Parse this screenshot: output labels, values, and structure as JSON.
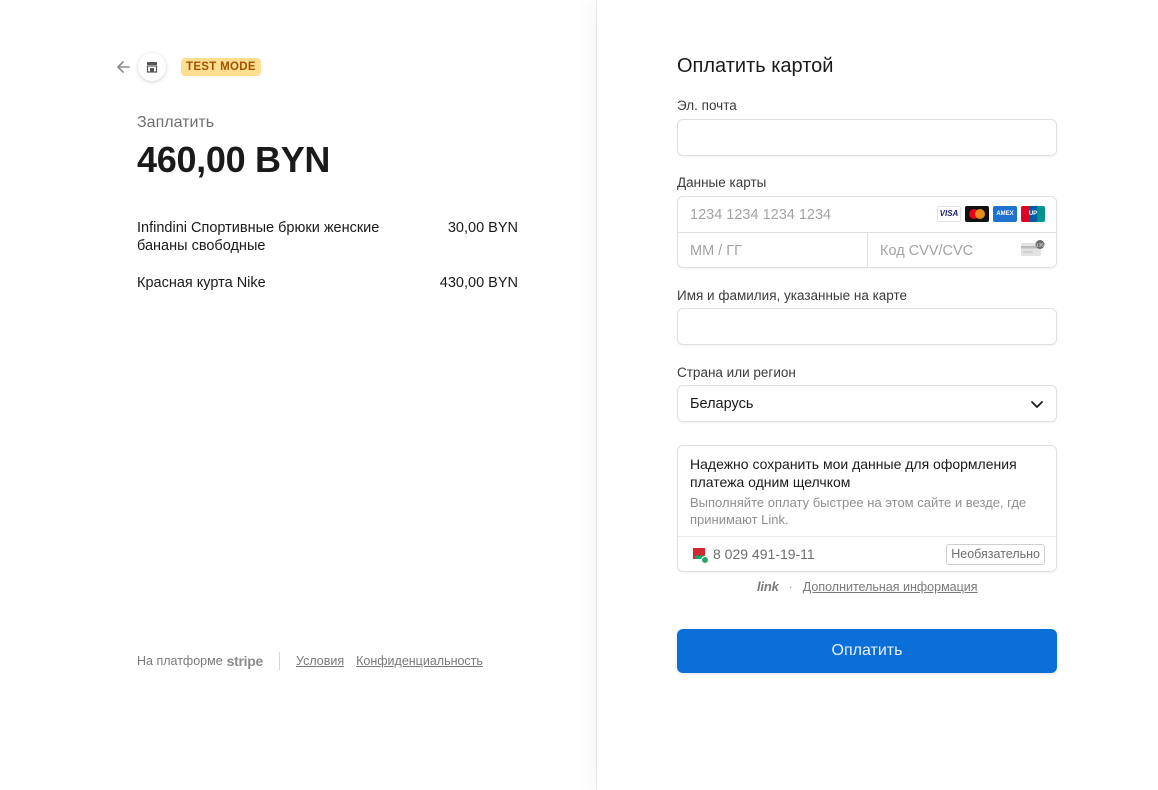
{
  "header": {
    "test_mode_label": "TEST MODE",
    "back_icon": "arrow-left-icon",
    "store_icon": "store-icon"
  },
  "summary": {
    "pay_label": "Заплатить",
    "amount": "460,00 BYN",
    "items": [
      {
        "name": "Infindini Спортивные брюки женские бананы свободные",
        "price": "30,00 BYN"
      },
      {
        "name": "Красная курта Nike",
        "price": "430,00 BYN"
      }
    ]
  },
  "footer": {
    "powered_by": "На платформе",
    "brand": "stripe",
    "terms": "Условия",
    "privacy": "Конфиденциальность"
  },
  "form": {
    "title": "Оплатить картой",
    "email": {
      "label": "Эл. почта",
      "value": ""
    },
    "card": {
      "label": "Данные карты",
      "number_placeholder": "1234 1234 1234 1234",
      "expiry_placeholder": "ММ / ГГ",
      "cvc_placeholder": "Код CVV/CVC",
      "brands": [
        "visa",
        "mastercard",
        "amex",
        "unionpay"
      ],
      "visa_text": "VISA",
      "amex_text": "AMEX",
      "unionpay_text": "UP"
    },
    "cardholder": {
      "label": "Имя и фамилия, указанные на карте",
      "value": ""
    },
    "country": {
      "label": "Страна или регион",
      "value": "Беларусь"
    },
    "link_save": {
      "title": "Надежно сохранить мои данные для оформления платежа одним щелчком",
      "description": "Выполняйте оплату быстрее на этом сайте и везде, где принимают Link.",
      "phone": "8 029 491-19-11",
      "optional_label": "Необязательно"
    },
    "link_footer": {
      "brand": "link",
      "separator": "·",
      "more_info": "Дополнительная информация"
    },
    "submit_label": "Оплатить"
  },
  "colors": {
    "accent": "#0a6fd8",
    "test_mode_bg": "#ffde92",
    "test_mode_text": "#a35300"
  }
}
